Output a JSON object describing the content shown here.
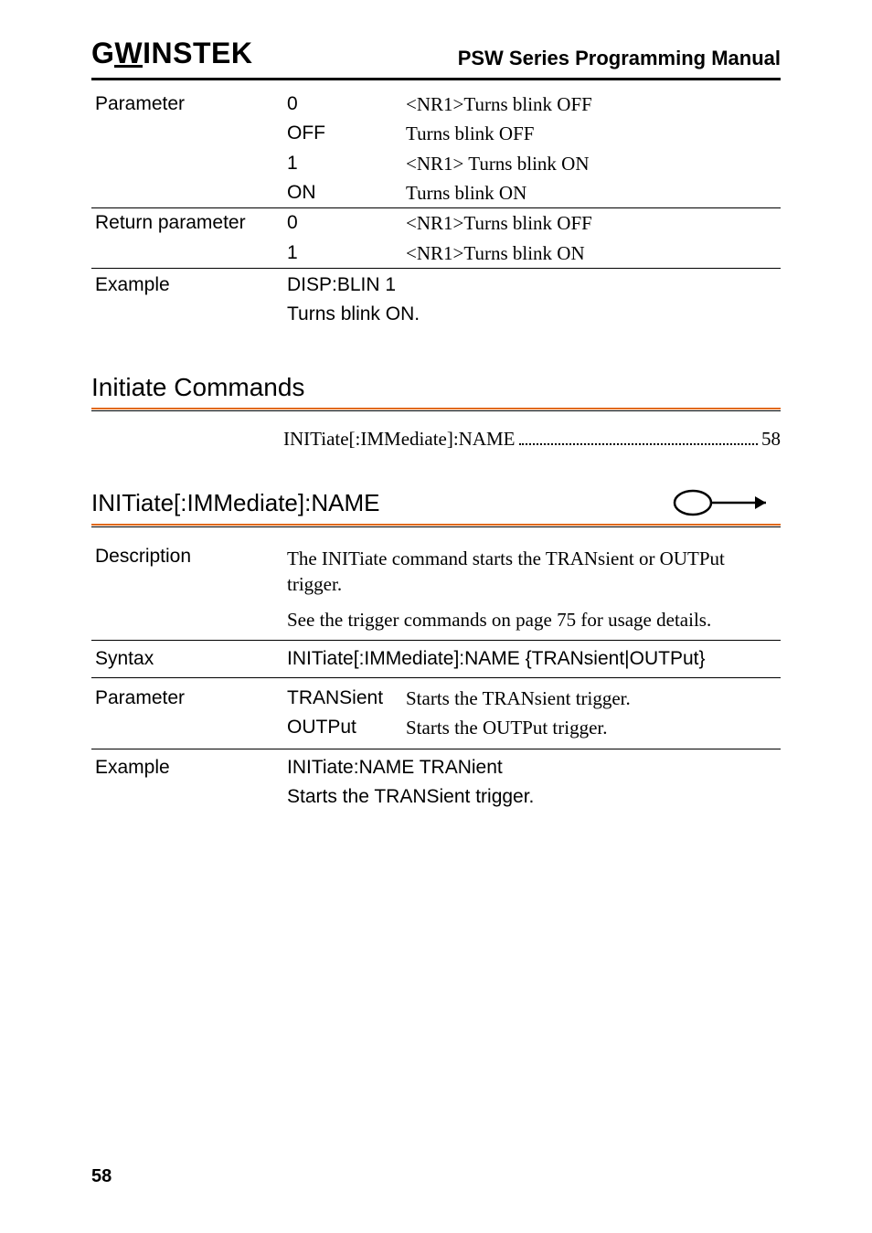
{
  "header": {
    "logo_pre": "G",
    "logo_u": "W",
    "logo_post": "INSTEK",
    "title": "PSW Series Programming Manual"
  },
  "param_table": {
    "label": "Parameter",
    "rows": [
      {
        "val": "0",
        "desc": "<NR1>Turns blink OFF"
      },
      {
        "val": "OFF",
        "desc": "Turns blink OFF"
      },
      {
        "val": "1",
        "desc": "<NR1> Turns blink ON"
      },
      {
        "val": "ON",
        "desc": "Turns blink ON"
      }
    ]
  },
  "return_table": {
    "label": "Return parameter",
    "rows": [
      {
        "val": "0",
        "desc": "<NR1>Turns blink OFF"
      },
      {
        "val": "1",
        "desc": "<NR1>Turns blink ON"
      }
    ]
  },
  "example1": {
    "label": "Example",
    "line1": "DISP:BLIN 1",
    "line2": "Turns blink ON."
  },
  "section": {
    "heading": "Initiate Commands",
    "toc_label": "INITiate[:IMMediate]:NAME",
    "toc_page": "58"
  },
  "subsection": {
    "heading": "INITiate[:IMMediate]:NAME"
  },
  "description": {
    "label": "Description",
    "p1": "The INITiate command starts the TRANsient or OUTPut trigger.",
    "p2": "See the trigger commands on page 75 for usage details."
  },
  "syntax": {
    "label": "Syntax",
    "body": "INITiate[:IMMediate]:NAME {TRANsient|OUTPut}"
  },
  "param2": {
    "label": "Parameter",
    "rows": [
      {
        "val": "TRANSient",
        "desc": "Starts the TRANsient trigger."
      },
      {
        "val": "OUTPut",
        "desc": "Starts the OUTPut trigger."
      }
    ]
  },
  "example2": {
    "label": "Example",
    "line1": "INITiate:NAME TRANient",
    "line2": "Starts the TRANSient trigger."
  },
  "page_number": "58"
}
